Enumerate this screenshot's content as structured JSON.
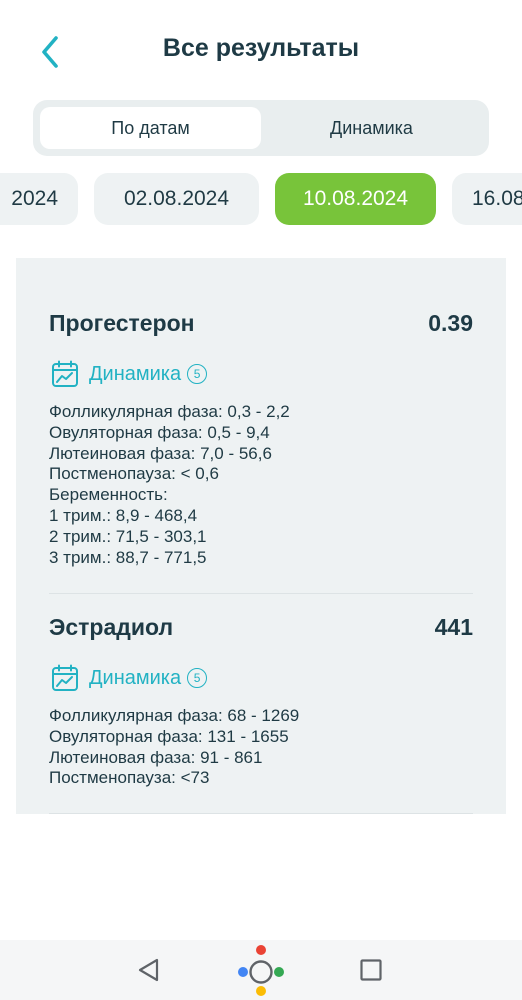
{
  "header": {
    "title": "Все результаты"
  },
  "tabs": [
    {
      "label": "По датам",
      "active": true
    },
    {
      "label": "Динамика",
      "active": false
    }
  ],
  "dates": [
    {
      "label": "2024",
      "selected": false
    },
    {
      "label": "02.08.2024",
      "selected": false
    },
    {
      "label": "10.08.2024",
      "selected": true
    },
    {
      "label": "16.08",
      "selected": false
    }
  ],
  "results": [
    {
      "name": "Прогестерон",
      "value": "0.39",
      "dynamics_label": "Динамика",
      "dynamics_count": "5",
      "ranges": [
        "Фолликулярная фаза: 0,3 - 2,2",
        "Овуляторная фаза: 0,5 - 9,4",
        "Лютеиновая фаза: 7,0 - 56,6",
        "Постменопауза: < 0,6",
        "Беременность:",
        "1 трим.: 8,9 - 468,4",
        "2 трим.: 71,5 - 303,1",
        "3 трим.: 88,7 - 771,5"
      ]
    },
    {
      "name": "Эстрадиол",
      "value": "441",
      "dynamics_label": "Динамика",
      "dynamics_count": "5",
      "ranges": [
        "Фолликулярная фаза: 68 - 1269",
        "Овуляторная фаза: 131 - 1655",
        "Лютеиновая фаза: 91 - 861",
        "Постменопауза: <73"
      ]
    }
  ],
  "colors": {
    "accent": "#22b2c3",
    "selected_date": "#78c43a",
    "text": "#1e3a45",
    "card_bg": "#eef2f3"
  },
  "icons": {
    "back": "chevron-left-icon",
    "dynamics": "calendar-chart-icon",
    "nav_back": "triangle-back-icon",
    "nav_home": "assistant-home-icon",
    "nav_recents": "square-recents-icon"
  }
}
